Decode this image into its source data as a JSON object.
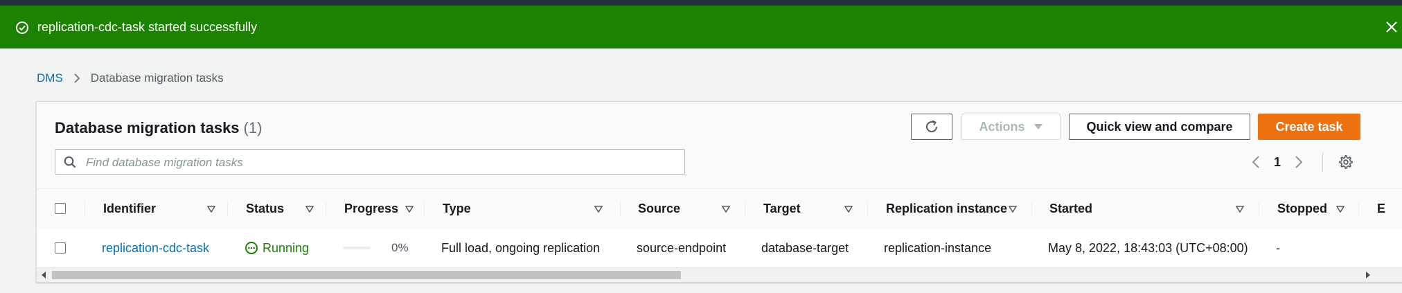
{
  "flash": {
    "message": "replication-cdc-task started successfully",
    "color": "#1d8102"
  },
  "breadcrumb": {
    "root": "DMS",
    "current": "Database migration tasks"
  },
  "panel": {
    "title": "Database migration tasks",
    "count": "(1)"
  },
  "toolbar": {
    "refresh_icon": "refresh-icon",
    "actions_label": "Actions",
    "compare_label": "Quick view and compare",
    "create_label": "Create task",
    "accent": "#ec7211"
  },
  "search": {
    "placeholder": "Find database migration tasks",
    "value": ""
  },
  "pagination": {
    "current_page": "1"
  },
  "table": {
    "columns": [
      "Identifier",
      "Status",
      "Progress",
      "Type",
      "Source",
      "Target",
      "Replication instance",
      "Started",
      "Stopped",
      "E"
    ],
    "rows": [
      {
        "identifier": "replication-cdc-task",
        "status": "Running",
        "progress_percent": 0,
        "progress_text": "0%",
        "type": "Full load, ongoing replication",
        "source": "source-endpoint",
        "target": "database-target",
        "replication_instance": "replication-instance",
        "started": "May 8, 2022, 18:43:03 (UTC+08:00)",
        "stopped": "-"
      }
    ]
  }
}
